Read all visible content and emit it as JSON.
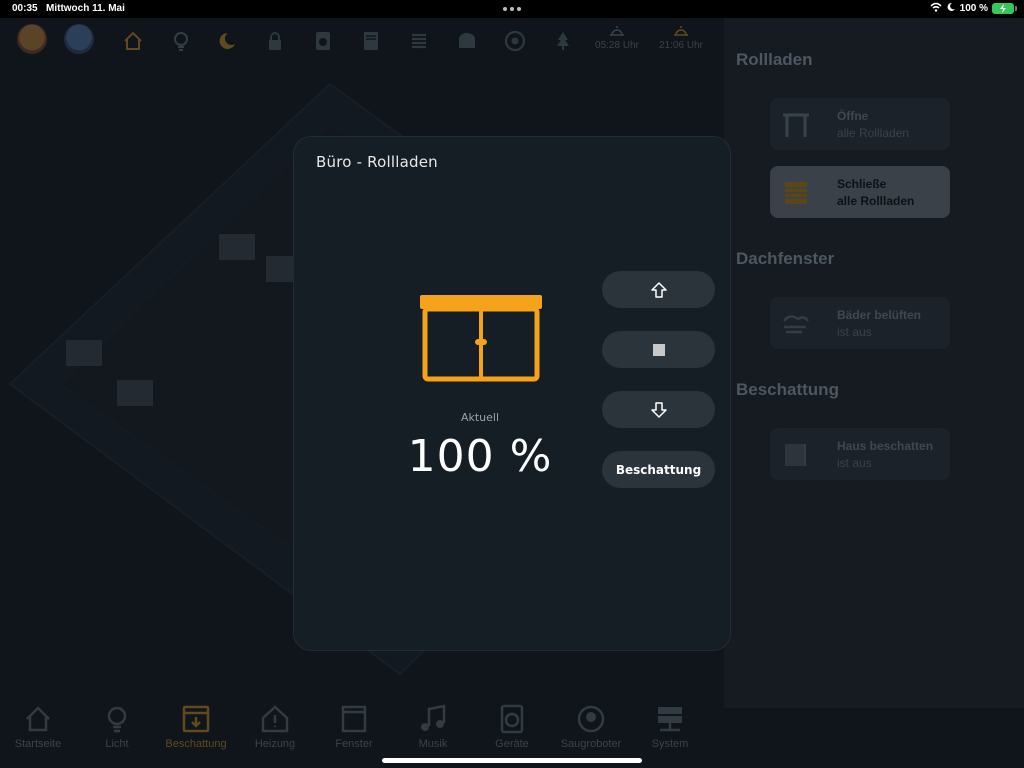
{
  "status_bar": {
    "time": "00:35",
    "date": "Mittwoch 11. Mai",
    "battery": "100 %",
    "battery_color": "#34c759"
  },
  "background_app": {
    "top_icons": [
      "home-icon",
      "bulb-icon",
      "moon-icon",
      "lock-icon",
      "washer-icon",
      "shutter-icon",
      "heater-icon",
      "mailbox-icon",
      "robot-vacuum-icon",
      "tree-icon"
    ],
    "sunrise": "05:28 Uhr",
    "sunset": "21:06 Uhr",
    "right_panel": {
      "sections": [
        {
          "title": "Rollladen",
          "cards": [
            {
              "line1": "Öffne",
              "line2": "alle Rollladen",
              "icon": "open-shutter-icon"
            },
            {
              "line1": "Schließe",
              "line2": "alle Rollladen",
              "icon": "closed-shutter-icon"
            }
          ]
        },
        {
          "title": "Dachfenster",
          "cards": [
            {
              "line1": "Bäder belüften",
              "line2": "ist aus",
              "icon": "ventilation-icon"
            }
          ]
        },
        {
          "title": "Beschattung",
          "cards": [
            {
              "line1": "Haus beschatten",
              "line2": "ist aus",
              "icon": "shade-icon"
            }
          ]
        }
      ]
    },
    "bottom_nav": [
      {
        "label": "Startseite",
        "icon": "home-icon"
      },
      {
        "label": "Licht",
        "icon": "bulb-icon"
      },
      {
        "label": "Beschattung",
        "icon": "shutter-icon",
        "active": true
      },
      {
        "label": "Heizung",
        "icon": "heating-icon"
      },
      {
        "label": "Fenster",
        "icon": "window-icon"
      },
      {
        "label": "Musik",
        "icon": "music-icon"
      },
      {
        "label": "Geräte",
        "icon": "appliance-icon"
      },
      {
        "label": "Saugroboter",
        "icon": "robot-vacuum-icon"
      },
      {
        "label": "System",
        "icon": "server-icon"
      }
    ]
  },
  "dialog": {
    "title": "Büro - Rollladen",
    "state_label": "Aktuell",
    "position": "100 %",
    "position_value": 100,
    "accent_color": "#f5a31a",
    "buttons": {
      "up": "arrow-up-icon",
      "stop": "stop-icon",
      "down": "arrow-down-icon",
      "shade_label": "Beschattung"
    }
  }
}
